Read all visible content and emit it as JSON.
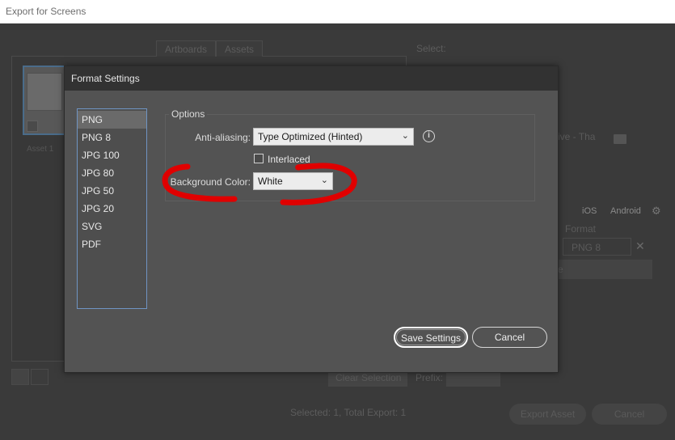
{
  "window": {
    "title": "Export for Screens"
  },
  "background": {
    "tabs": [
      "Artboards",
      "Assets"
    ],
    "asset_label": "Asset 1",
    "select_label": "Select:",
    "path_fragment": "ive - Tha",
    "platforms": [
      "iOS",
      "Android"
    ],
    "format_header": "Format",
    "format_value": "PNG 8",
    "suffix_fragment": "e",
    "clear_selection": "Clear Selection",
    "prefix_label": "Prefix:",
    "status": "Selected: 1, Total Export: 1",
    "export_button": "Export Asset",
    "cancel_button": "Cancel"
  },
  "dialog": {
    "title": "Format Settings",
    "formats": [
      "PNG",
      "PNG 8",
      "JPG 100",
      "JPG 80",
      "JPG 50",
      "JPG 20",
      "SVG",
      "PDF"
    ],
    "selected_format": "PNG",
    "options": {
      "legend": "Options",
      "antialiasing_label": "Anti-aliasing:",
      "antialiasing_value": "Type Optimized (Hinted)",
      "interlaced_label": "Interlaced",
      "interlaced_checked": false,
      "background_color_label": "Background Color:",
      "background_color_value": "White"
    },
    "save_button": "Save Settings",
    "cancel_button": "Cancel"
  },
  "icons": {
    "info": "info-icon",
    "chevron": "chevron-down-icon",
    "folder": "folder-icon",
    "gear": "gear-icon",
    "close": "close-icon"
  },
  "colors": {
    "dialog_bg": "#535353",
    "list_border": "#6f94c3",
    "annotation_red": "#e00000"
  }
}
